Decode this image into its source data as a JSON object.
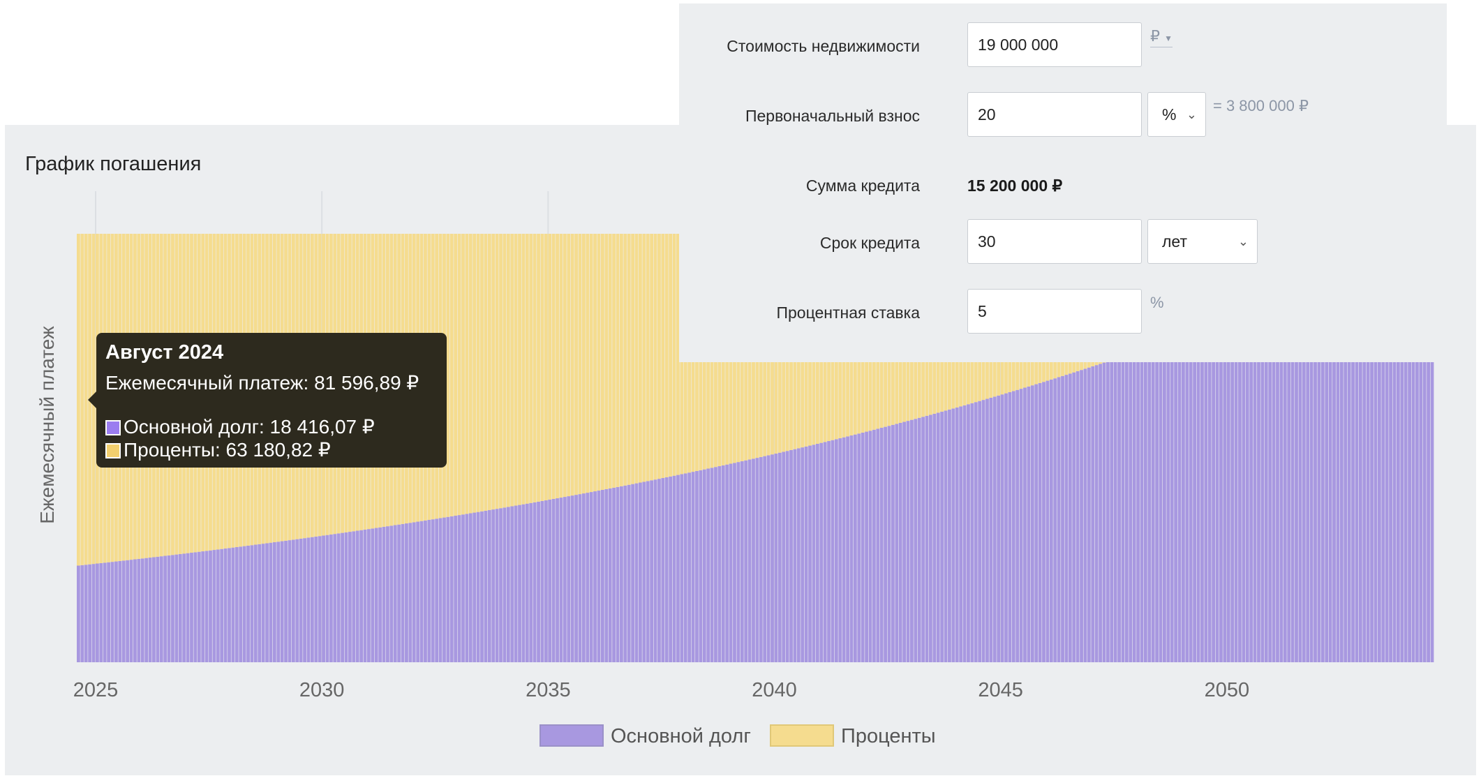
{
  "chart_title": "График погашения",
  "form": {
    "price": {
      "label": "Стоимость недвижимости",
      "value": "19 000 000",
      "currency": "₽"
    },
    "down_payment": {
      "label": "Первоначальный взнос",
      "value": "20",
      "unit": "%",
      "result": "= 3 800 000 ₽"
    },
    "loan_amount": {
      "label": "Сумма кредита",
      "value": "15 200 000 ₽"
    },
    "term": {
      "label": "Срок кредита",
      "value": "30",
      "unit": "лет"
    },
    "rate": {
      "label": "Процентная ставка",
      "value": "5",
      "unit": "%"
    }
  },
  "tooltip": {
    "title": "Август 2024",
    "payment": "Ежемесячный платеж: 81 596,89 ₽",
    "principal": "Основной долг: 18 416,07 ₽",
    "interest": "Проценты: 63 180,82 ₽"
  },
  "chart_data": {
    "type": "bar",
    "stacked": true,
    "ylabel": "Ежемесячный платеж",
    "xlabel": "",
    "x_start": "2024-08",
    "x_end": "2054-07",
    "x_ticks": [
      "2025",
      "2030",
      "2035",
      "2040",
      "2045",
      "2050"
    ],
    "monthly_payment": 81596.89,
    "first_month": {
      "principal": 18416.07,
      "interest": 63180.82
    },
    "annual_rate_percent": 5,
    "months": 360,
    "series": [
      {
        "name": "Основной долг",
        "color": "#a898e0"
      },
      {
        "name": "Проценты",
        "color": "#f5dc8f"
      }
    ],
    "legend_position": "bottom",
    "grid": true
  },
  "colors": {
    "principal": "#a898e0",
    "interest": "#f5dc8f",
    "principal_tooltip": "#9b7df0",
    "interest_tooltip": "#f2cf6e"
  }
}
